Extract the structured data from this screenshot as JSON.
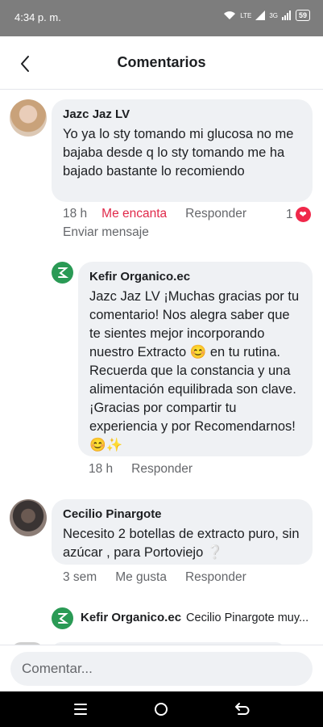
{
  "status_bar": {
    "time": "4:34 p. m.",
    "network": "LTE",
    "signal": "3G",
    "battery": "59"
  },
  "header": {
    "title": "Comentarios"
  },
  "comments": [
    {
      "author": "Jazc  Jaz LV",
      "text": "Yo ya lo sty tomando mi glucosa no me bajaba desde q lo sty tomando me ha bajado bastante lo recomiendo",
      "time": "18 h",
      "like_label": "Me encanta",
      "reply_label": "Responder",
      "reaction_count": "1",
      "send_message_label": "Enviar mensaje"
    },
    {
      "author": "Kefir Organico.ec",
      "text": "Jazc  Jaz LV ¡Muchas gracias por tu comentario! Nos alegra saber que te sientes mejor incorporando nuestro Extracto 😊 en tu rutina. Recuerda que la constancia y una alimentación equilibrada son clave. ¡Gracias por compartir tu experiencia y por Recomendarnos!😊✨",
      "time": "18 h",
      "reply_label": "Responder"
    },
    {
      "author": "Cecilio Pinargote",
      "text": "Necesito 2 botellas de extracto puro, sin azúcar , para Portoviejo ❔",
      "time": "3 sem",
      "like_label": "Me gusta",
      "reply_label": "Responder"
    }
  ],
  "collapsed_reply": {
    "author": "Kefir Organico.ec",
    "preview": "Cecilio Pinargote muy..."
  },
  "composer": {
    "placeholder": "Comentar..."
  },
  "colors": {
    "liked": "#e0294a",
    "bubble": "#eff1f4",
    "brand_green": "#2a9a55"
  }
}
